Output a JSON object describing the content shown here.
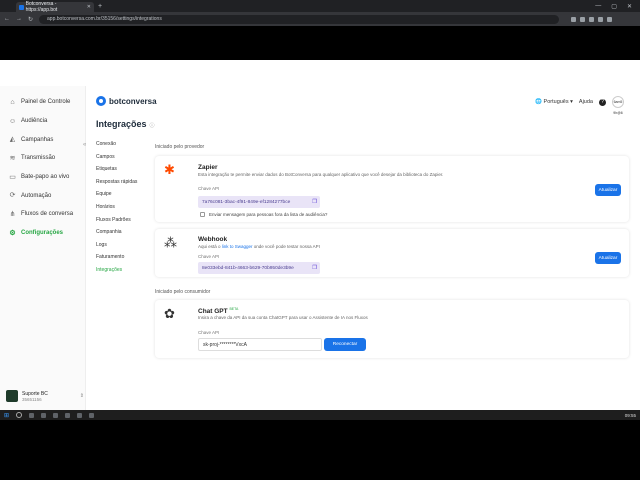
{
  "browser": {
    "tab_title": "Botconversa - https://app.bot",
    "url": "app.botconversa.com.br/35156/settings/integrations"
  },
  "sidebar": {
    "items": [
      {
        "label": "Painel de Controle",
        "icon": "home-icon"
      },
      {
        "label": "Audiência",
        "icon": "users-icon"
      },
      {
        "label": "Campanhas",
        "icon": "megaphone-icon"
      },
      {
        "label": "Transmissão",
        "icon": "broadcast-icon"
      },
      {
        "label": "Bate-papo ao vivo",
        "icon": "chat-icon"
      },
      {
        "label": "Automação",
        "icon": "automation-icon"
      },
      {
        "label": "Fluxos de conversa",
        "icon": "flow-icon"
      },
      {
        "label": "Configurações",
        "icon": "gear-icon"
      }
    ],
    "account": {
      "name": "Suporte BC",
      "id": "35651156"
    }
  },
  "header": {
    "logo_text": "botconversa",
    "language": "Português",
    "help": "Ajuda",
    "avatar_text": "6am5 9h@6"
  },
  "page": {
    "title": "Integrações",
    "subnav": [
      "Conexão",
      "Campos",
      "Etiquetas",
      "Respostas rápidas",
      "Equipe",
      "Horários",
      "Fluxos Padrões",
      "Companhia",
      "Logs",
      "Faturamento",
      "Integrações"
    ],
    "section_provider": "Iniciado pelo provedor",
    "section_consumer": "Iniciado pelo consumidor",
    "zapier": {
      "name": "Zapier",
      "desc": "Esta integração te permite enviar dados do BotConversa para qualquer aplicativo que você desejar da biblioteca do Zapier.",
      "key_label": "Chave API",
      "key_value": "7a76c081-3bac-4f91-849e-ef1284277bce",
      "button": "Atualizar",
      "checkbox_label": "Enviar mensagem para pessoas fora da lista de audiência?"
    },
    "webhook": {
      "name": "Webhook",
      "desc_pre": "Aqui está o ",
      "desc_link": "link to Swagger",
      "desc_post": " onde você pode testar nossa API",
      "key_label": "Chave API",
      "key_value": "8e033ebd-841b-4663-b629-70b950de3b9e",
      "button": "Atualizar"
    },
    "chatgpt": {
      "name": "Chat GPT",
      "badge": "BETA",
      "desc": "Insira a chave da API da sua conta ChatGPT para usar o Assistente de IA nos Fluxos",
      "key_label": "Chave API",
      "key_value": "sk-proj-********VxcA",
      "button": "Reconectar"
    }
  },
  "taskbar": {
    "time": "09:55"
  }
}
